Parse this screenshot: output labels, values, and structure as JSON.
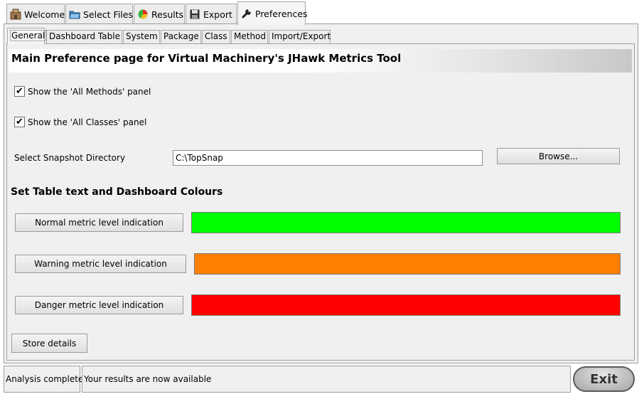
{
  "main_tabs": [
    {
      "label": "Welcome",
      "icon": "welcome-icon"
    },
    {
      "label": "Select Files",
      "icon": "folder-icon"
    },
    {
      "label": "Results",
      "icon": "pie-chart-icon"
    },
    {
      "label": "Export",
      "icon": "save-icon"
    },
    {
      "label": "Preferences",
      "icon": "wrench-icon",
      "active": true
    }
  ],
  "sub_tabs": [
    {
      "label": "General",
      "active": true
    },
    {
      "label": "Dashboard Table"
    },
    {
      "label": "System"
    },
    {
      "label": "Package"
    },
    {
      "label": "Class"
    },
    {
      "label": "Method"
    },
    {
      "label": "Import/Export"
    }
  ],
  "banner": {
    "title": "Main Preference page for Virtual Machinery's JHawk Metrics Tool"
  },
  "options": {
    "all_methods": {
      "label": "Show the 'All Methods' panel",
      "checked": true
    },
    "all_classes": {
      "label": "Show the 'All Classes' panel",
      "checked": true
    }
  },
  "snapshot": {
    "label": "Select Snapshot Directory",
    "value": "C:\\TopSnap",
    "browse_label": "Browse..."
  },
  "colours": {
    "title": "Set Table text and Dashboard Colours",
    "normal": {
      "label": "Normal metric level indication",
      "color": "#00ff00"
    },
    "warning": {
      "label": "Warning metric level indication",
      "color": "#ff8000"
    },
    "danger": {
      "label": "Danger metric level indication",
      "color": "#ff0000"
    }
  },
  "store_label": "Store details",
  "status": {
    "state": "Analysis complete",
    "message": "Your results are now available",
    "exit_label": "Exit"
  }
}
